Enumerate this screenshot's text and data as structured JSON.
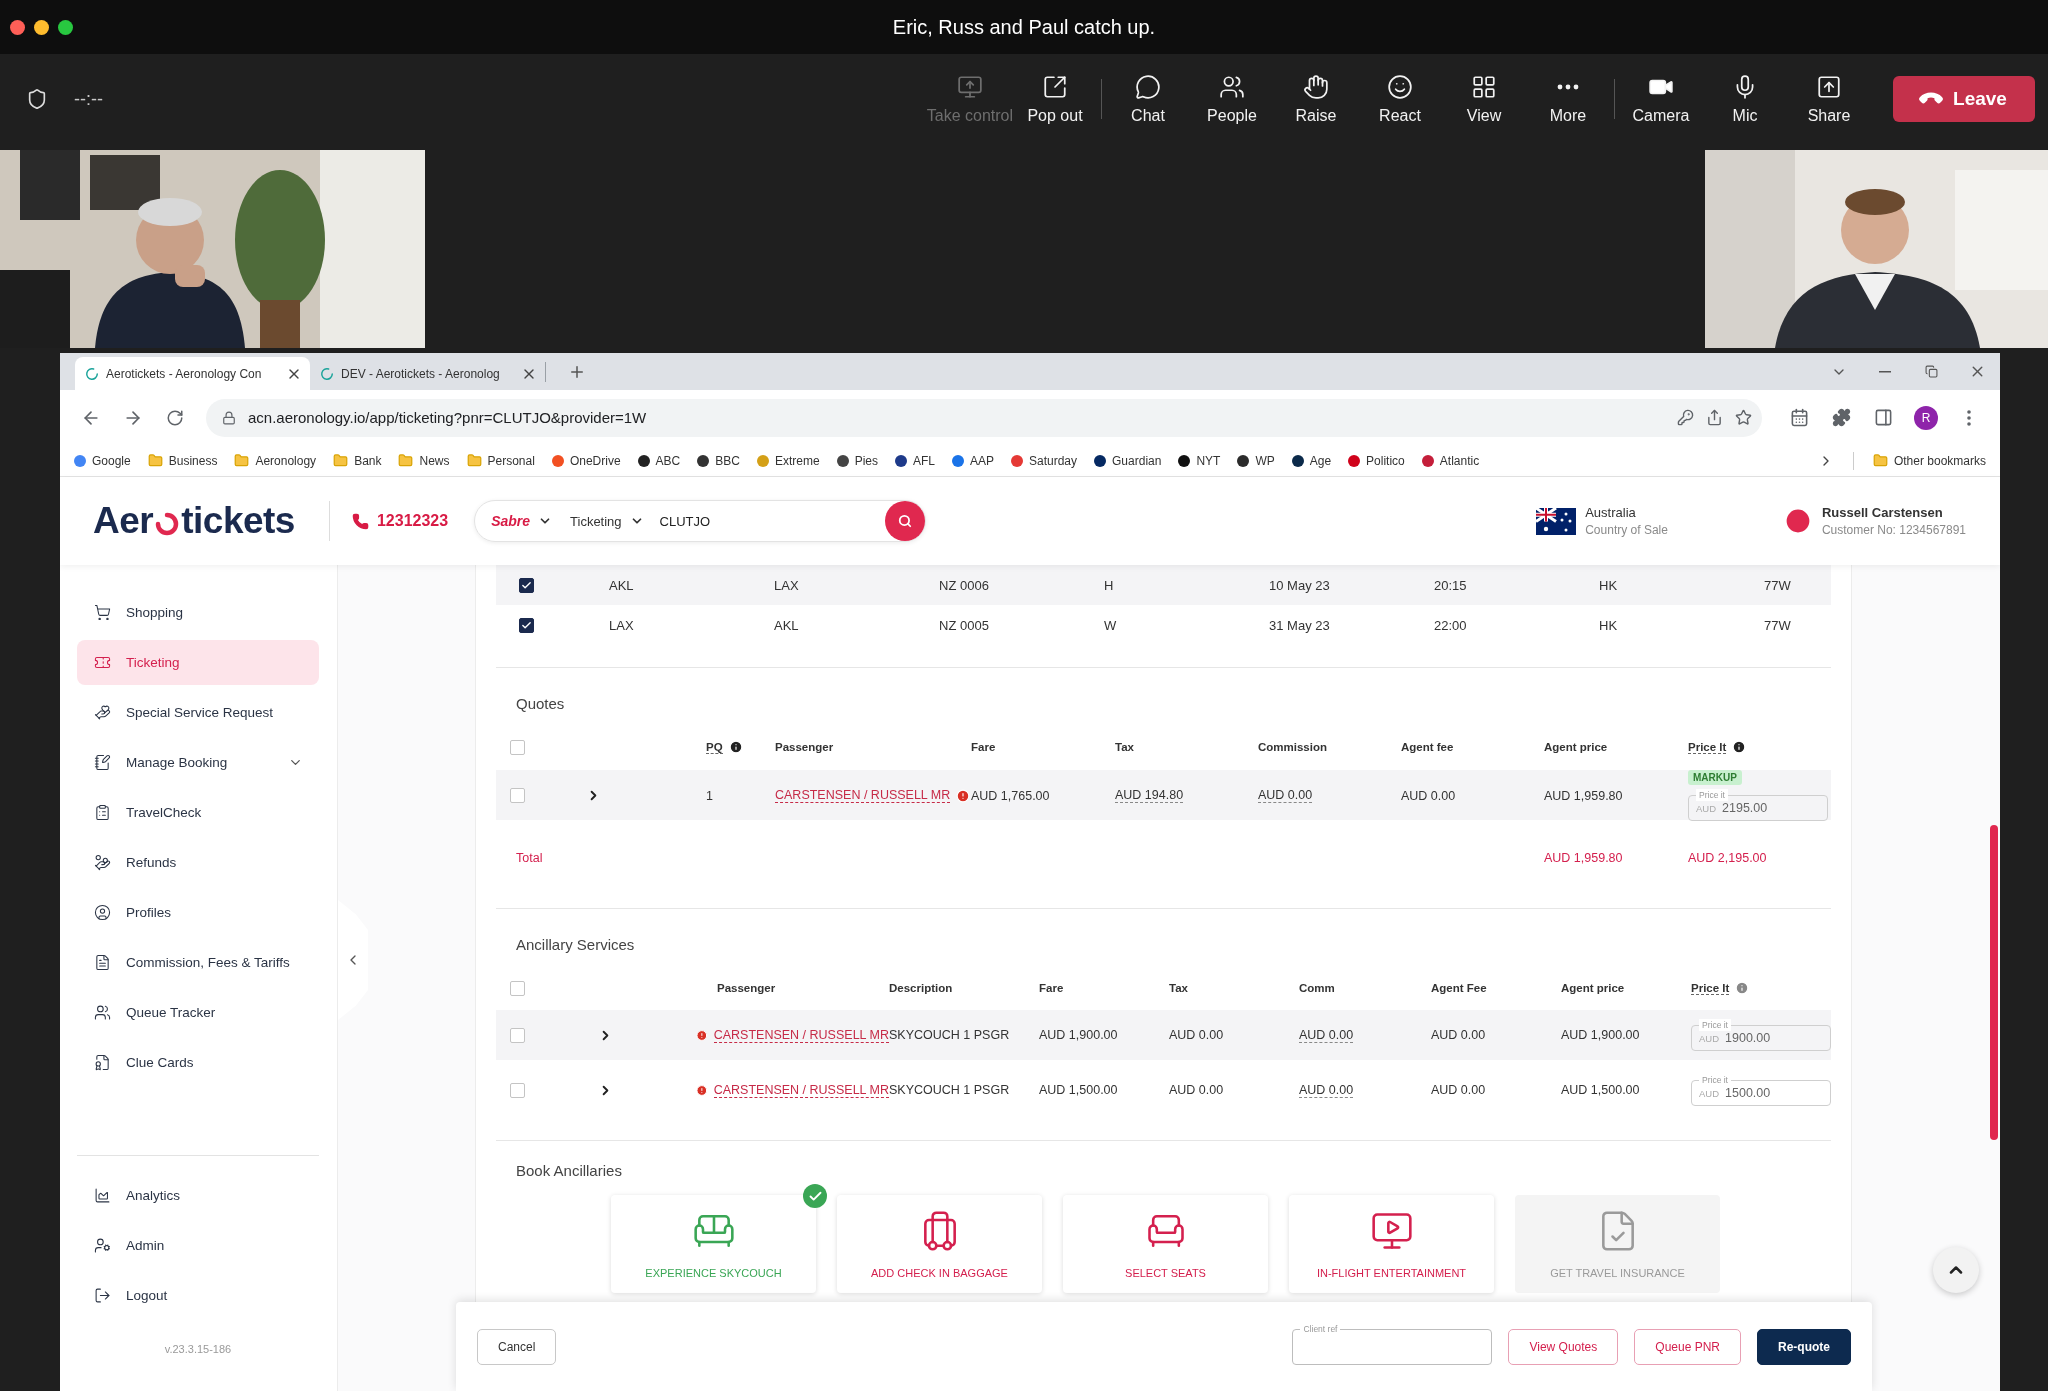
{
  "meeting": {
    "title": "Eric, Russ and Paul catch up.",
    "timer": "--:--",
    "toolbar_groups": [
      [
        {
          "label": "Take control",
          "kind": "control",
          "disabled": true
        },
        {
          "label": "Pop out",
          "kind": "popout",
          "disabled": false
        }
      ],
      [
        {
          "label": "Chat",
          "kind": "chat",
          "disabled": false
        },
        {
          "label": "People",
          "kind": "people",
          "disabled": false
        },
        {
          "label": "Raise",
          "kind": "raise",
          "disabled": false
        },
        {
          "label": "React",
          "kind": "react",
          "disabled": false
        },
        {
          "label": "View",
          "kind": "view",
          "disabled": false
        },
        {
          "label": "More",
          "kind": "more",
          "disabled": false
        }
      ],
      [
        {
          "label": "Camera",
          "kind": "camera",
          "disabled": false
        },
        {
          "label": "Mic",
          "kind": "mic",
          "disabled": false
        },
        {
          "label": "Share",
          "kind": "share",
          "disabled": false
        }
      ]
    ],
    "leave": "Leave",
    "videos": [
      {
        "kind": "picture"
      },
      {
        "kind": "picture"
      }
    ]
  },
  "browser": {
    "tabs": [
      {
        "title": "Aerotickets - Aeronology Con",
        "selected": true
      },
      {
        "title": "DEV - Aerotickets - Aeronolog",
        "selected": false
      }
    ],
    "url": "acn.aeronology.io/app/ticketing?pnr=CLUTJO&provider=1W",
    "profile": "R",
    "bookmarks": [
      {
        "label": "Google",
        "kind": "site",
        "color": "#4285f4"
      },
      {
        "label": "Business",
        "kind": "folder"
      },
      {
        "label": "Aeronology",
        "kind": "folder"
      },
      {
        "label": "Bank",
        "kind": "folder"
      },
      {
        "label": "News",
        "kind": "folder"
      },
      {
        "label": "Personal",
        "kind": "folder"
      },
      {
        "label": "OneDrive",
        "kind": "site",
        "color": "#f25022"
      },
      {
        "label": "ABC",
        "kind": "site",
        "color": "#222222"
      },
      {
        "label": "BBC",
        "kind": "site",
        "color": "#333333"
      },
      {
        "label": "Extreme",
        "kind": "site",
        "color": "#d4a017"
      },
      {
        "label": "Pies",
        "kind": "site",
        "color": "#444444"
      },
      {
        "label": "AFL",
        "kind": "site",
        "color": "#1e3a8a"
      },
      {
        "label": "AAP",
        "kind": "site",
        "color": "#1a73e8"
      },
      {
        "label": "Saturday",
        "kind": "site",
        "color": "#e53935"
      },
      {
        "label": "Guardian",
        "kind": "site",
        "color": "#052962"
      },
      {
        "label": "NYT",
        "kind": "site",
        "color": "#111111"
      },
      {
        "label": "WP",
        "kind": "site",
        "color": "#2b2b2b"
      },
      {
        "label": "Age",
        "kind": "site",
        "color": "#0b2a4a"
      },
      {
        "label": "Politico",
        "kind": "site",
        "color": "#d0021b"
      },
      {
        "label": "Atlantic",
        "kind": "site",
        "color": "#c41e3a"
      }
    ],
    "other_bookmarks": "Other bookmarks"
  },
  "app": {
    "logo": {
      "before": "Aer",
      "after": "tickets"
    },
    "phone": "12312323",
    "search": {
      "provider": "Sabre",
      "mode": "Ticketing",
      "value": "CLUTJO"
    },
    "country": {
      "name": "Australia",
      "caption": "Country of Sale"
    },
    "user": {
      "name": "Russell Carstensen",
      "caption": "Customer No: 1234567891"
    },
    "sidebar": {
      "items": [
        {
          "label": "Shopping",
          "kind": "cart",
          "selected": false,
          "expandable": false
        },
        {
          "label": "Ticketing",
          "kind": "ticket",
          "selected": true,
          "expandable": false
        },
        {
          "label": "Special Service Request",
          "kind": "ssr",
          "selected": false,
          "expandable": false
        },
        {
          "label": "Manage Booking",
          "kind": "booking",
          "selected": false,
          "expandable": true
        },
        {
          "label": "TravelCheck",
          "kind": "check",
          "selected": false,
          "expandable": false
        },
        {
          "label": "Refunds",
          "kind": "refund",
          "selected": false,
          "expandable": false
        },
        {
          "label": "Profiles",
          "kind": "profile",
          "selected": false,
          "expandable": false
        },
        {
          "label": "Commission, Fees & Tariffs",
          "kind": "fees",
          "selected": false,
          "expandable": false
        },
        {
          "label": "Queue Tracker",
          "kind": "queue",
          "selected": false,
          "expandable": false
        },
        {
          "label": "Clue Cards",
          "kind": "cards",
          "selected": false,
          "expandable": false
        }
      ],
      "bottom_items": [
        {
          "label": "Analytics",
          "kind": "analytics",
          "selected": false
        },
        {
          "label": "Admin",
          "kind": "admin",
          "selected": false
        },
        {
          "label": "Logout",
          "kind": "logout",
          "selected": false
        }
      ],
      "version": "v.23.3.15-186"
    },
    "segments": [
      {
        "checked": true,
        "cells": [
          "AKL",
          "LAX",
          "NZ 0006",
          "H",
          "10 May 23",
          "20:15",
          "HK",
          "77W"
        ]
      },
      {
        "checked": true,
        "cells": [
          "LAX",
          "AKL",
          "NZ 0005",
          "W",
          "31 May 23",
          "22:00",
          "HK",
          "77W"
        ]
      }
    ],
    "quotes": {
      "title": "Quotes",
      "all_checked": false,
      "columns": [
        {
          "label": "PQ",
          "info": true
        },
        {
          "label": "Passenger",
          "info": false
        },
        {
          "label": "Fare",
          "info": false
        },
        {
          "label": "Tax",
          "info": false
        },
        {
          "label": "Commission",
          "info": false
        },
        {
          "label": "Agent fee",
          "info": false
        },
        {
          "label": "Agent price",
          "info": false
        },
        {
          "label": "Price It",
          "info": true
        }
      ],
      "rows": [
        {
          "checked": false,
          "pq": "1",
          "passenger": "CARSTENSEN / RUSSELL MR",
          "fare": "AUD 1,765.00",
          "tax": "AUD 194.80",
          "commission": "AUD 0.00",
          "agent_fee": "AUD 0.00",
          "agent_price": "AUD 1,959.80",
          "badge": "MARKUP",
          "price_it": {
            "label": "Price it",
            "currency": "AUD",
            "value": "2195.00"
          }
        }
      ],
      "total": {
        "label": "Total",
        "agent_price": "AUD 1,959.80",
        "price_it": "AUD 2,195.00"
      }
    },
    "ancillary": {
      "title": "Ancillary Services",
      "all_checked": false,
      "columns": [
        {
          "label": "Passenger",
          "info": false
        },
        {
          "label": "Description",
          "info": false
        },
        {
          "label": "Fare",
          "info": false
        },
        {
          "label": "Tax",
          "info": false
        },
        {
          "label": "Comm",
          "info": false
        },
        {
          "label": "Agent Fee",
          "info": false
        },
        {
          "label": "Agent price",
          "info": false
        },
        {
          "label": "Price It",
          "info": true
        }
      ],
      "rows": [
        {
          "checked": false,
          "passenger": "CARSTENSEN / RUSSELL MR",
          "description": "SKYCOUCH 1 PSGR",
          "fare": "AUD 1,900.00",
          "tax": "AUD 0.00",
          "comm": "AUD 0.00",
          "agent_fee": "AUD 0.00",
          "agent_price": "AUD 1,900.00",
          "price_it": {
            "label": "Price it",
            "currency": "AUD",
            "value": "1900.00"
          }
        },
        {
          "checked": false,
          "passenger": "CARSTENSEN / RUSSELL MR",
          "description": "SKYCOUCH 1 PSGR",
          "fare": "AUD 1,500.00",
          "tax": "AUD 0.00",
          "comm": "AUD 0.00",
          "agent_fee": "AUD 0.00",
          "agent_price": "AUD 1,500.00",
          "price_it": {
            "label": "Price it",
            "currency": "AUD",
            "value": "1500.00"
          }
        }
      ]
    },
    "book_ancillaries": {
      "title": "Book Ancillaries",
      "cards": [
        {
          "label": "EXPERIENCE SKYCOUCH",
          "kind": "skycouch",
          "selected": true,
          "disabled": false
        },
        {
          "label": "ADD CHECK IN BAGGAGE",
          "kind": "baggage",
          "selected": false,
          "disabled": false
        },
        {
          "label": "SELECT SEATS",
          "kind": "seats",
          "selected": false,
          "disabled": false
        },
        {
          "label": "IN-FLIGHT ENTERTAINMENT",
          "kind": "entertainment",
          "selected": false,
          "disabled": false
        },
        {
          "label": "GET TRAVEL INSURANCE",
          "kind": "insurance",
          "selected": false,
          "disabled": true
        }
      ]
    },
    "footer": {
      "cancel": "Cancel",
      "client_ref": {
        "label": "Client ref"
      },
      "buttons": [
        "View Quotes",
        "Queue PNR"
      ],
      "primary": "Re-quote"
    }
  }
}
